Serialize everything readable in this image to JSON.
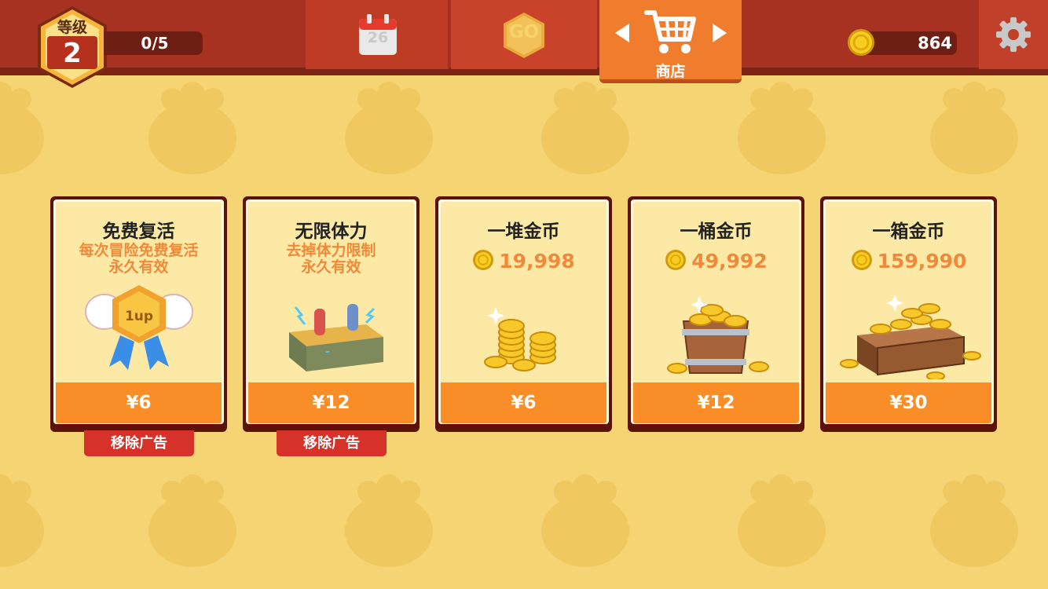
{
  "header": {
    "level_label": "等级",
    "level_value": "2",
    "xp_progress": "0/5",
    "calendar_day": "26",
    "go_label": "GO",
    "shop_label": "商店",
    "coins": "864",
    "icons": {
      "level": "hexagon-level-badge-icon",
      "calendar": "calendar-icon",
      "go": "go-hexagon-icon",
      "shop": "shopping-cart-icon",
      "prev": "arrow-left-icon",
      "next": "arrow-right-icon",
      "coin": "coin-icon",
      "settings": "gear-icon"
    }
  },
  "shop": {
    "items": [
      {
        "title": "免费复活",
        "desc1": "每次冒险免费复活",
        "desc2": "永久有效",
        "price": "¥6",
        "badge": "移除广告",
        "icon": "winged-1up-medal-icon"
      },
      {
        "title": "无限体力",
        "desc1": "去掉体力限制",
        "desc2": "永久有效",
        "price": "¥12",
        "badge": "移除广告",
        "icon": "battery-pack-icon"
      },
      {
        "title": "一堆金币",
        "amount": "19,998",
        "price": "¥6",
        "icon": "coin-pile-icon"
      },
      {
        "title": "一桶金币",
        "amount": "49,992",
        "price": "¥12",
        "icon": "coin-bucket-icon"
      },
      {
        "title": "一箱金币",
        "amount": "159,990",
        "price": "¥30",
        "icon": "coin-chest-icon"
      }
    ]
  },
  "colors": {
    "background": "#f5d473",
    "topbar": "#a83222",
    "shop_tab": "#f07d2e",
    "price_bar": "#f98e29",
    "accent_text": "#f0893a",
    "badge": "#d7322a"
  }
}
